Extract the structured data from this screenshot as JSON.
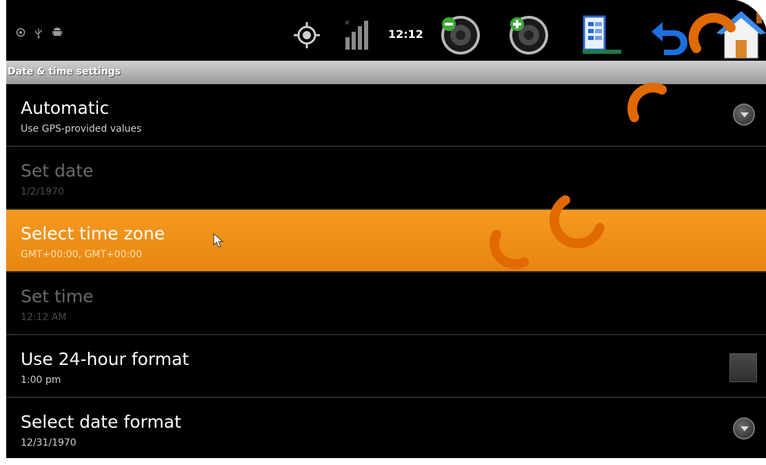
{
  "status_bar": {
    "time": "12:12",
    "left_icons": [
      "settings-icon",
      "usb-icon",
      "android-debug-icon"
    ],
    "right_icons": [
      "gps-icon",
      "signal-icon",
      "volume-down-icon",
      "volume-up-icon",
      "menu-icon",
      "back-icon",
      "home-icon"
    ]
  },
  "title_bar": {
    "title": "Date & time settings"
  },
  "settings": [
    {
      "title": "Automatic",
      "subtitle": "Use GPS-provided values",
      "state": "enabled",
      "control": "dropdown"
    },
    {
      "title": "Set date",
      "subtitle": "1/2/1970",
      "state": "disabled",
      "control": "none"
    },
    {
      "title": "Select time zone",
      "subtitle": "GMT+00:00, GMT+00:00",
      "state": "selected",
      "control": "none"
    },
    {
      "title": "Set time",
      "subtitle": "12:12 AM",
      "state": "disabled",
      "control": "none"
    },
    {
      "title": "Use 24-hour format",
      "subtitle": "1:00 pm",
      "state": "enabled",
      "control": "checkbox",
      "checked": false
    },
    {
      "title": "Select date format",
      "subtitle": "12/31/1970",
      "state": "enabled",
      "control": "dropdown"
    }
  ],
  "colors": {
    "background": "#000000",
    "highlight": "#f39220",
    "title_bar": "#b5b5b5",
    "watermark": "#e06a00"
  }
}
